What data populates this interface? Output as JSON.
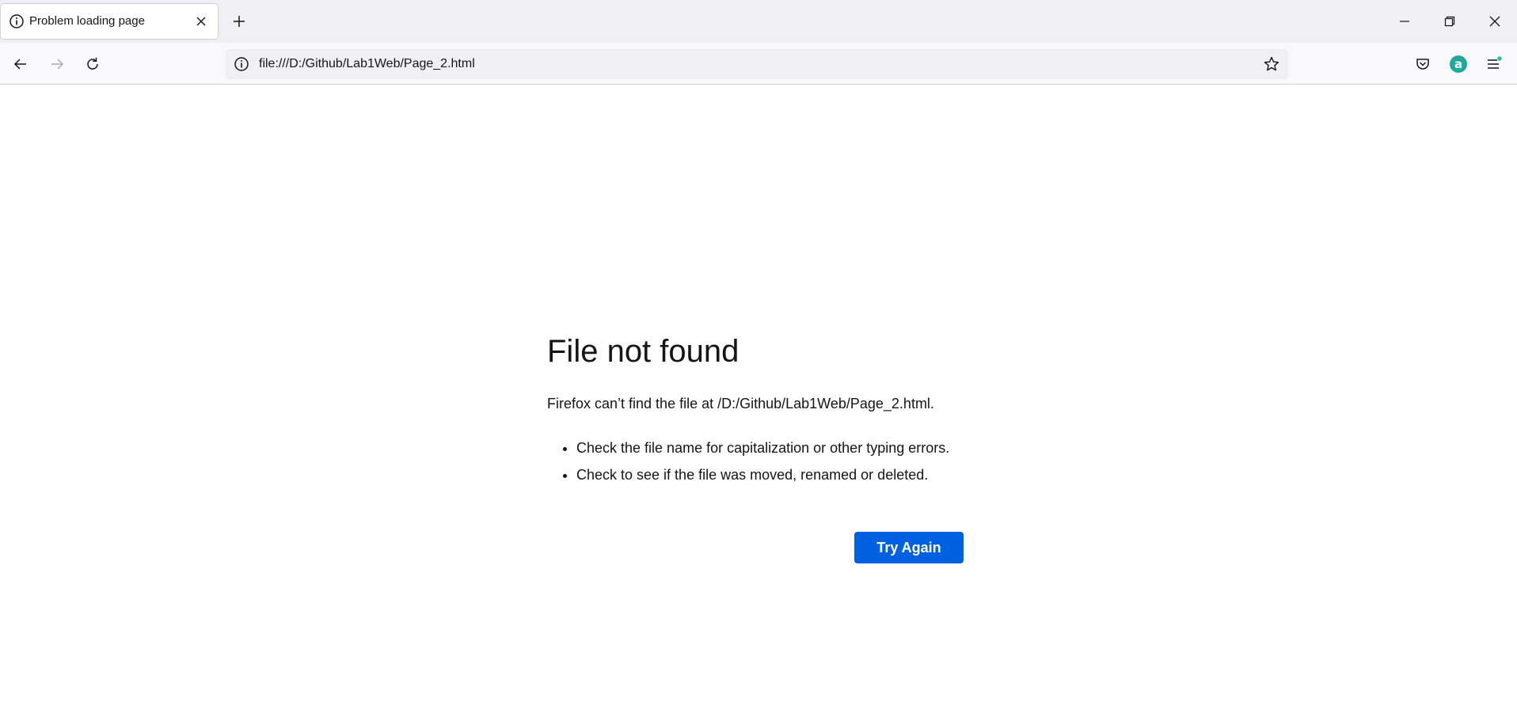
{
  "browser": {
    "tab": {
      "title": "Problem loading page",
      "icon": "info-icon"
    },
    "new_tab_icon": "plus-icon",
    "window_controls": [
      "minimize-icon",
      "restore-icon",
      "close-icon"
    ],
    "nav": {
      "back_icon": "arrow-left-icon",
      "forward_icon": "arrow-right-icon",
      "reload_icon": "reload-icon"
    },
    "urlbar": {
      "url": "file:///D:/Github/Lab1Web/Page_2.html",
      "site_icon": "info-icon",
      "bookmark_icon": "star-icon"
    },
    "toolbar_right": {
      "pocket_icon": "pocket-icon",
      "account_initial": "a",
      "account_color": "#1fa99a",
      "menu_icon": "hamburger-menu-icon",
      "notification_dot_color": "#2ac3a2"
    }
  },
  "error_page": {
    "title": "File not found",
    "description": "Firefox can’t find the file at /D:/Github/Lab1Web/Page_2.html.",
    "suggestions": [
      "Check the file name for capitalization or other typing errors.",
      "Check to see if the file was moved, renamed or deleted."
    ],
    "button_label": "Try Again",
    "button_color": "#0061e0"
  }
}
